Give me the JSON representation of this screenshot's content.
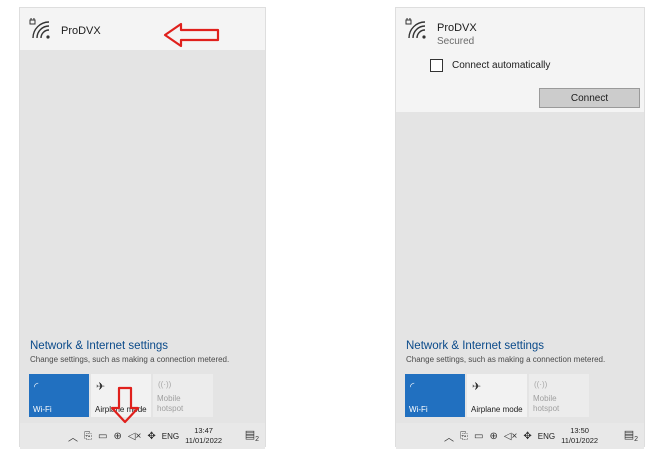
{
  "panel_a": {
    "network": {
      "name": "ProDVX"
    },
    "settings": {
      "link": "Network & Internet settings",
      "description": "Change settings, such as making a connection metered."
    },
    "tiles": [
      {
        "label": "Wi-Fi",
        "icon": "wifi-icon"
      },
      {
        "label": "Airplane mode",
        "icon": "airplane-icon"
      },
      {
        "label_line1": "Mobile",
        "label_line2": "hotspot",
        "icon": "hotspot-icon"
      }
    ],
    "taskbar": {
      "lang": "ENG",
      "time": "13:47",
      "date": "11/01/2022",
      "notifications": "2"
    }
  },
  "panel_b": {
    "network": {
      "name": "ProDVX",
      "status": "Secured",
      "checkbox_label": "Connect automatically",
      "connect_label": "Connect"
    },
    "settings": {
      "link": "Network & Internet settings",
      "description": "Change settings, such as making a connection metered."
    },
    "tiles": [
      {
        "label": "Wi-Fi",
        "icon": "wifi-icon"
      },
      {
        "label": "Airplane mode",
        "icon": "airplane-icon"
      },
      {
        "label_line1": "Mobile",
        "label_line2": "hotspot",
        "icon": "hotspot-icon"
      }
    ],
    "taskbar": {
      "lang": "ENG",
      "time": "13:50",
      "date": "11/01/2022",
      "notifications": "2"
    }
  },
  "colors": {
    "accent": "#2170c0",
    "annotation": "#e0201c"
  }
}
